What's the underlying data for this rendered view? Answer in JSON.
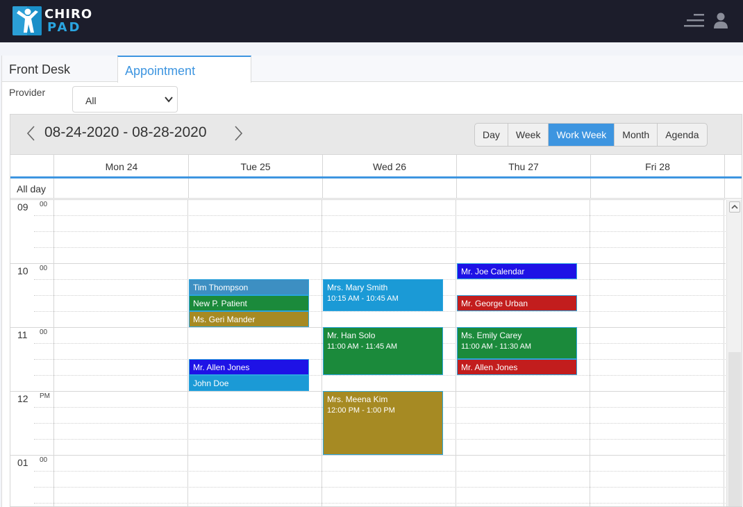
{
  "app": {
    "logo_line1": "CHIRO",
    "logo_line2": "PAD"
  },
  "tabs": [
    {
      "label": "Front Desk",
      "active": false
    },
    {
      "label": "Appointment",
      "active": true
    }
  ],
  "filters": {
    "provider_label": "Provider",
    "provider_value": "All"
  },
  "scheduler": {
    "date_range": "08-24-2020 - 08-28-2020",
    "views": [
      "Day",
      "Week",
      "Work Week",
      "Month",
      "Agenda"
    ],
    "active_view": "Work Week",
    "days": [
      "Mon 24",
      "Tue 25",
      "Wed 26",
      "Thu 27",
      "Fri 28"
    ],
    "all_day_label": "All day",
    "hours": [
      {
        "hour": "09",
        "suffix": "00"
      },
      {
        "hour": "10",
        "suffix": "00"
      },
      {
        "hour": "11",
        "suffix": "00"
      },
      {
        "hour": "12",
        "suffix": "PM"
      },
      {
        "hour": "01",
        "suffix": "00"
      }
    ],
    "appointments": [
      {
        "day": 1,
        "start": 10.25,
        "end": 10.5,
        "name": "Tim Thompson",
        "time": "",
        "color": "#3d8fc2"
      },
      {
        "day": 1,
        "start": 10.5,
        "end": 10.75,
        "name": "New P. Patient",
        "time": "",
        "color": "#1b8a3b"
      },
      {
        "day": 1,
        "start": 10.75,
        "end": 11.0,
        "name": "Ms. Geri Mander",
        "time": "",
        "color": "#a68a23"
      },
      {
        "day": 1,
        "start": 11.5,
        "end": 11.75,
        "name": "Mr. Allen Jones",
        "time": "",
        "color": "#1e12e6"
      },
      {
        "day": 1,
        "start": 11.75,
        "end": 12.0,
        "name": "John Doe",
        "time": "",
        "color": "#1b9ad6"
      },
      {
        "day": 2,
        "start": 10.25,
        "end": 10.75,
        "name": "Mrs. Mary Smith",
        "time": "10:15 AM - 10:45 AM",
        "color": "#1b9ad6"
      },
      {
        "day": 2,
        "start": 11.0,
        "end": 11.75,
        "name": "Mr. Han Solo",
        "time": "11:00 AM - 11:45 AM",
        "color": "#1b8a3b"
      },
      {
        "day": 2,
        "start": 12.0,
        "end": 13.0,
        "name": "Mrs. Meena Kim",
        "time": "12:00 PM - 1:00 PM",
        "color": "#a68a23"
      },
      {
        "day": 3,
        "start": 10.0,
        "end": 10.25,
        "name": "Mr. Joe Calendar",
        "time": "",
        "color": "#1e12e6"
      },
      {
        "day": 3,
        "start": 10.5,
        "end": 10.75,
        "name": "Mr. George Urban",
        "time": "",
        "color": "#c21d1d"
      },
      {
        "day": 3,
        "start": 11.0,
        "end": 11.5,
        "name": "Ms. Emily Carey",
        "time": "11:00 AM - 11:30 AM",
        "color": "#1b8a3b"
      },
      {
        "day": 3,
        "start": 11.5,
        "end": 11.75,
        "name": "Mr. Allen Jones",
        "time": "",
        "color": "#c21d1d"
      }
    ]
  },
  "colors": {
    "accent": "#3d95e0",
    "topbar": "#1c1d2b"
  },
  "icons": {
    "menu": "menu-lines-icon",
    "user": "user-icon",
    "prev": "chevron-left-icon",
    "next": "chevron-right-icon"
  }
}
